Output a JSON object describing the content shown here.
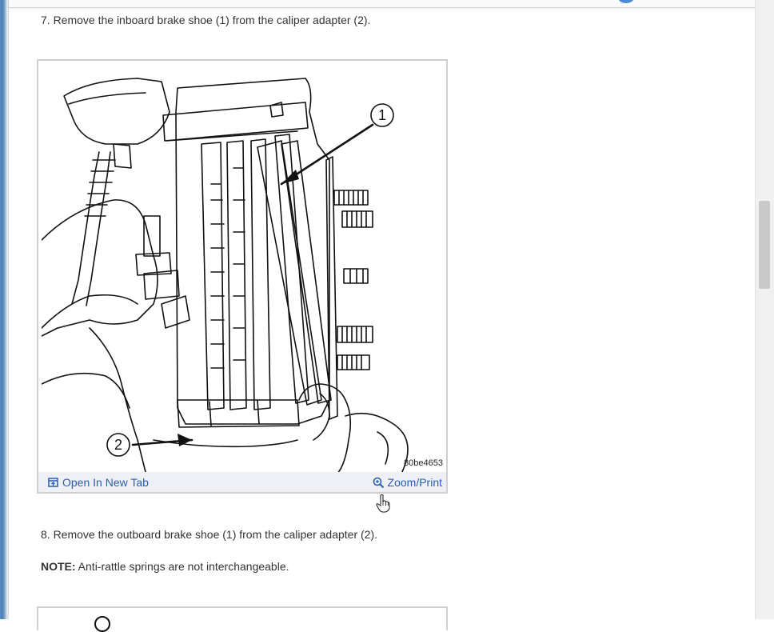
{
  "steps": {
    "step7": "7. Remove the inboard brake shoe (1) from the caliper adapter (2).",
    "step8": "8. Remove the outboard brake shoe (1) from the caliper adapter (2).",
    "note_label": "NOTE:",
    "note_text": " Anti-rattle springs are not interchangeable."
  },
  "figure": {
    "callout_1": "1",
    "callout_2": "2",
    "id": "80be4653",
    "open_label": "Open In New Tab",
    "zoom_label": "Zoom/Print",
    "open_icon": "open-new-tab-icon",
    "zoom_icon": "zoom-icon"
  },
  "colors": {
    "link": "#2a5db0",
    "caption_bar": "#eef0f5",
    "left_accent": "#4a7fb8"
  }
}
